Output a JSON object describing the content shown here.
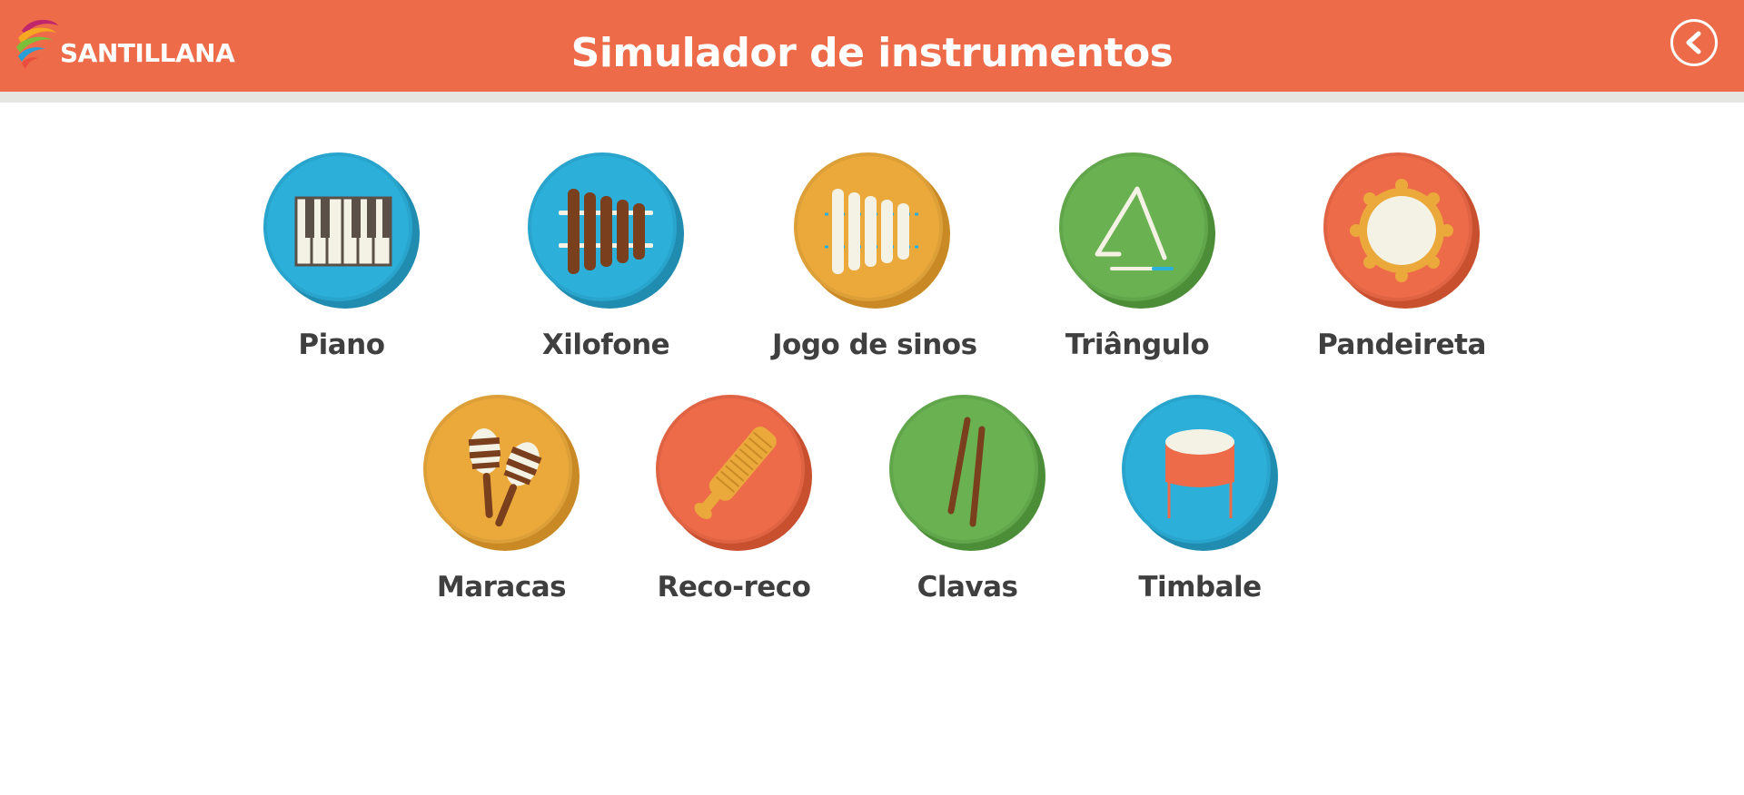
{
  "header": {
    "brand": "SANTILLANA",
    "title": "Simulador de instrumentos",
    "back_icon": "chevron-left-icon",
    "color": "#ee6b49"
  },
  "instruments": [
    {
      "label": "Piano",
      "icon": "piano-icon",
      "color": "#2cb0da"
    },
    {
      "label": "Xilofone",
      "icon": "xylophone-icon",
      "color": "#2cb0da"
    },
    {
      "label": "Jogo de sinos",
      "icon": "glockenspiel-icon",
      "color": "#eba93c"
    },
    {
      "label": "Triângulo",
      "icon": "triangle-icon",
      "color": "#69b151"
    },
    {
      "label": "Pandeireta",
      "icon": "tambourine-icon",
      "color": "#ee6b49"
    },
    {
      "label": "Maracas",
      "icon": "maracas-icon",
      "color": "#eba93c"
    },
    {
      "label": "Reco-reco",
      "icon": "guiro-icon",
      "color": "#ee6b49"
    },
    {
      "label": "Clavas",
      "icon": "claves-icon",
      "color": "#69b151"
    },
    {
      "label": "Timbale",
      "icon": "timbale-icon",
      "color": "#2cb0da"
    }
  ]
}
